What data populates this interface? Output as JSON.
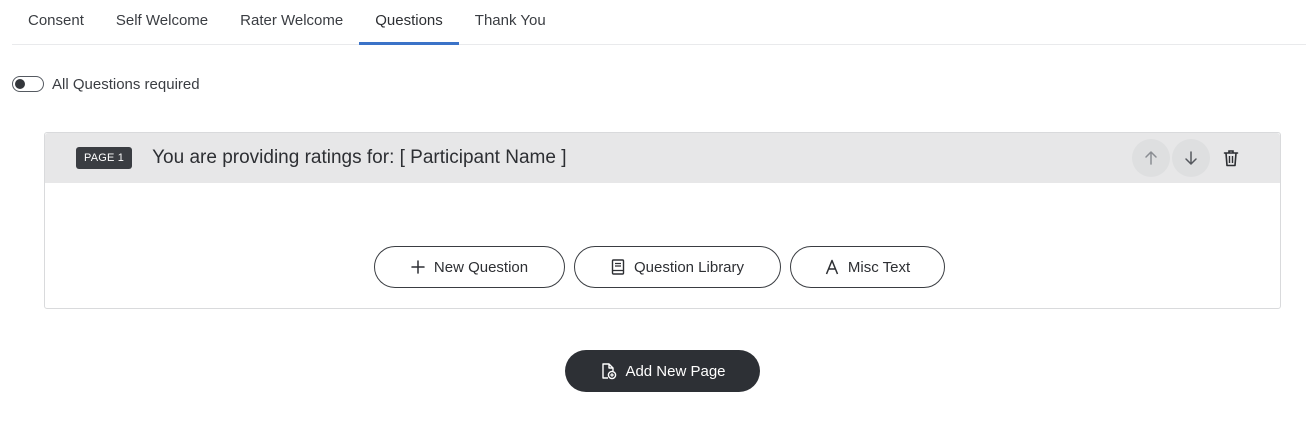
{
  "tabs": [
    {
      "label": "Consent",
      "active": false
    },
    {
      "label": "Self Welcome",
      "active": false
    },
    {
      "label": "Rater Welcome",
      "active": false
    },
    {
      "label": "Questions",
      "active": true
    },
    {
      "label": "Thank You",
      "active": false
    }
  ],
  "toggle": {
    "label": "All Questions required",
    "on": false
  },
  "page": {
    "badge": "PAGE 1",
    "title": "You are providing ratings for: [ Participant Name ]",
    "actions": {
      "up_icon": "arrow-up-icon",
      "down_icon": "arrow-down-icon",
      "delete_icon": "trash-icon"
    }
  },
  "buttons": {
    "new_question": "New Question",
    "question_library": "Question Library",
    "misc_text": "Misc Text",
    "add_new_page": "Add New Page"
  },
  "colors": {
    "accent": "#3b73c8",
    "dark_button": "#2d3035",
    "header_bg": "#e7e7e8"
  }
}
